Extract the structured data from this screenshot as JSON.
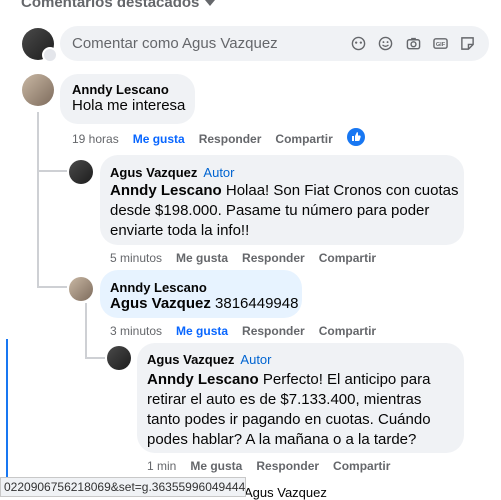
{
  "header": {
    "title": "Comentarios destacados"
  },
  "composer": {
    "placeholder": "Comentar como Agus Vazquez"
  },
  "comments": [
    {
      "author": "Anndy Lescano",
      "text": "Hola me interesa",
      "time": "19 horas",
      "like": "Me gusta",
      "reply": "Responder",
      "share": "Compartir"
    },
    {
      "author": "Agus Vazquez",
      "badge": "Autor",
      "mention": "Anndy Lescano",
      "text_line1": " Holaa! Son Fiat Cronos con cuotas",
      "text_line2": "desde $198.000. Pasame tu número para poder",
      "text_line3": "enviarte toda la info!!",
      "time": "5 minutos",
      "like": "Me gusta",
      "reply": "Responder",
      "share": "Compartir"
    },
    {
      "author": "Anndy Lescano",
      "mention": "Agus Vazquez",
      "text": " 3816449948",
      "time": "3 minutos",
      "like": "Me gusta",
      "reply": "Responder",
      "share": "Compartir"
    },
    {
      "author": "Agus Vazquez",
      "badge": "Autor",
      "mention": "Anndy Lescano",
      "text_line1": " Perfecto! El anticipo para",
      "text_line2": "retirar el auto es de $7.133.400, mientras",
      "text_line3": "tanto podes ir pagando en cuotas. Cuándo",
      "text_line4": "podes hablar? A la mañana o a la tarde?",
      "time": "1 min",
      "like": "Me gusta",
      "reply": "Responder",
      "share": "Compartir"
    }
  ],
  "status_url": "0220906756218069&set=g.363559960494440",
  "bottom_partial": "Agus Vazquez",
  "colors": {
    "accent": "#1877f2",
    "author_badge": "#0064d1",
    "bubble": "#f0f2f5"
  }
}
